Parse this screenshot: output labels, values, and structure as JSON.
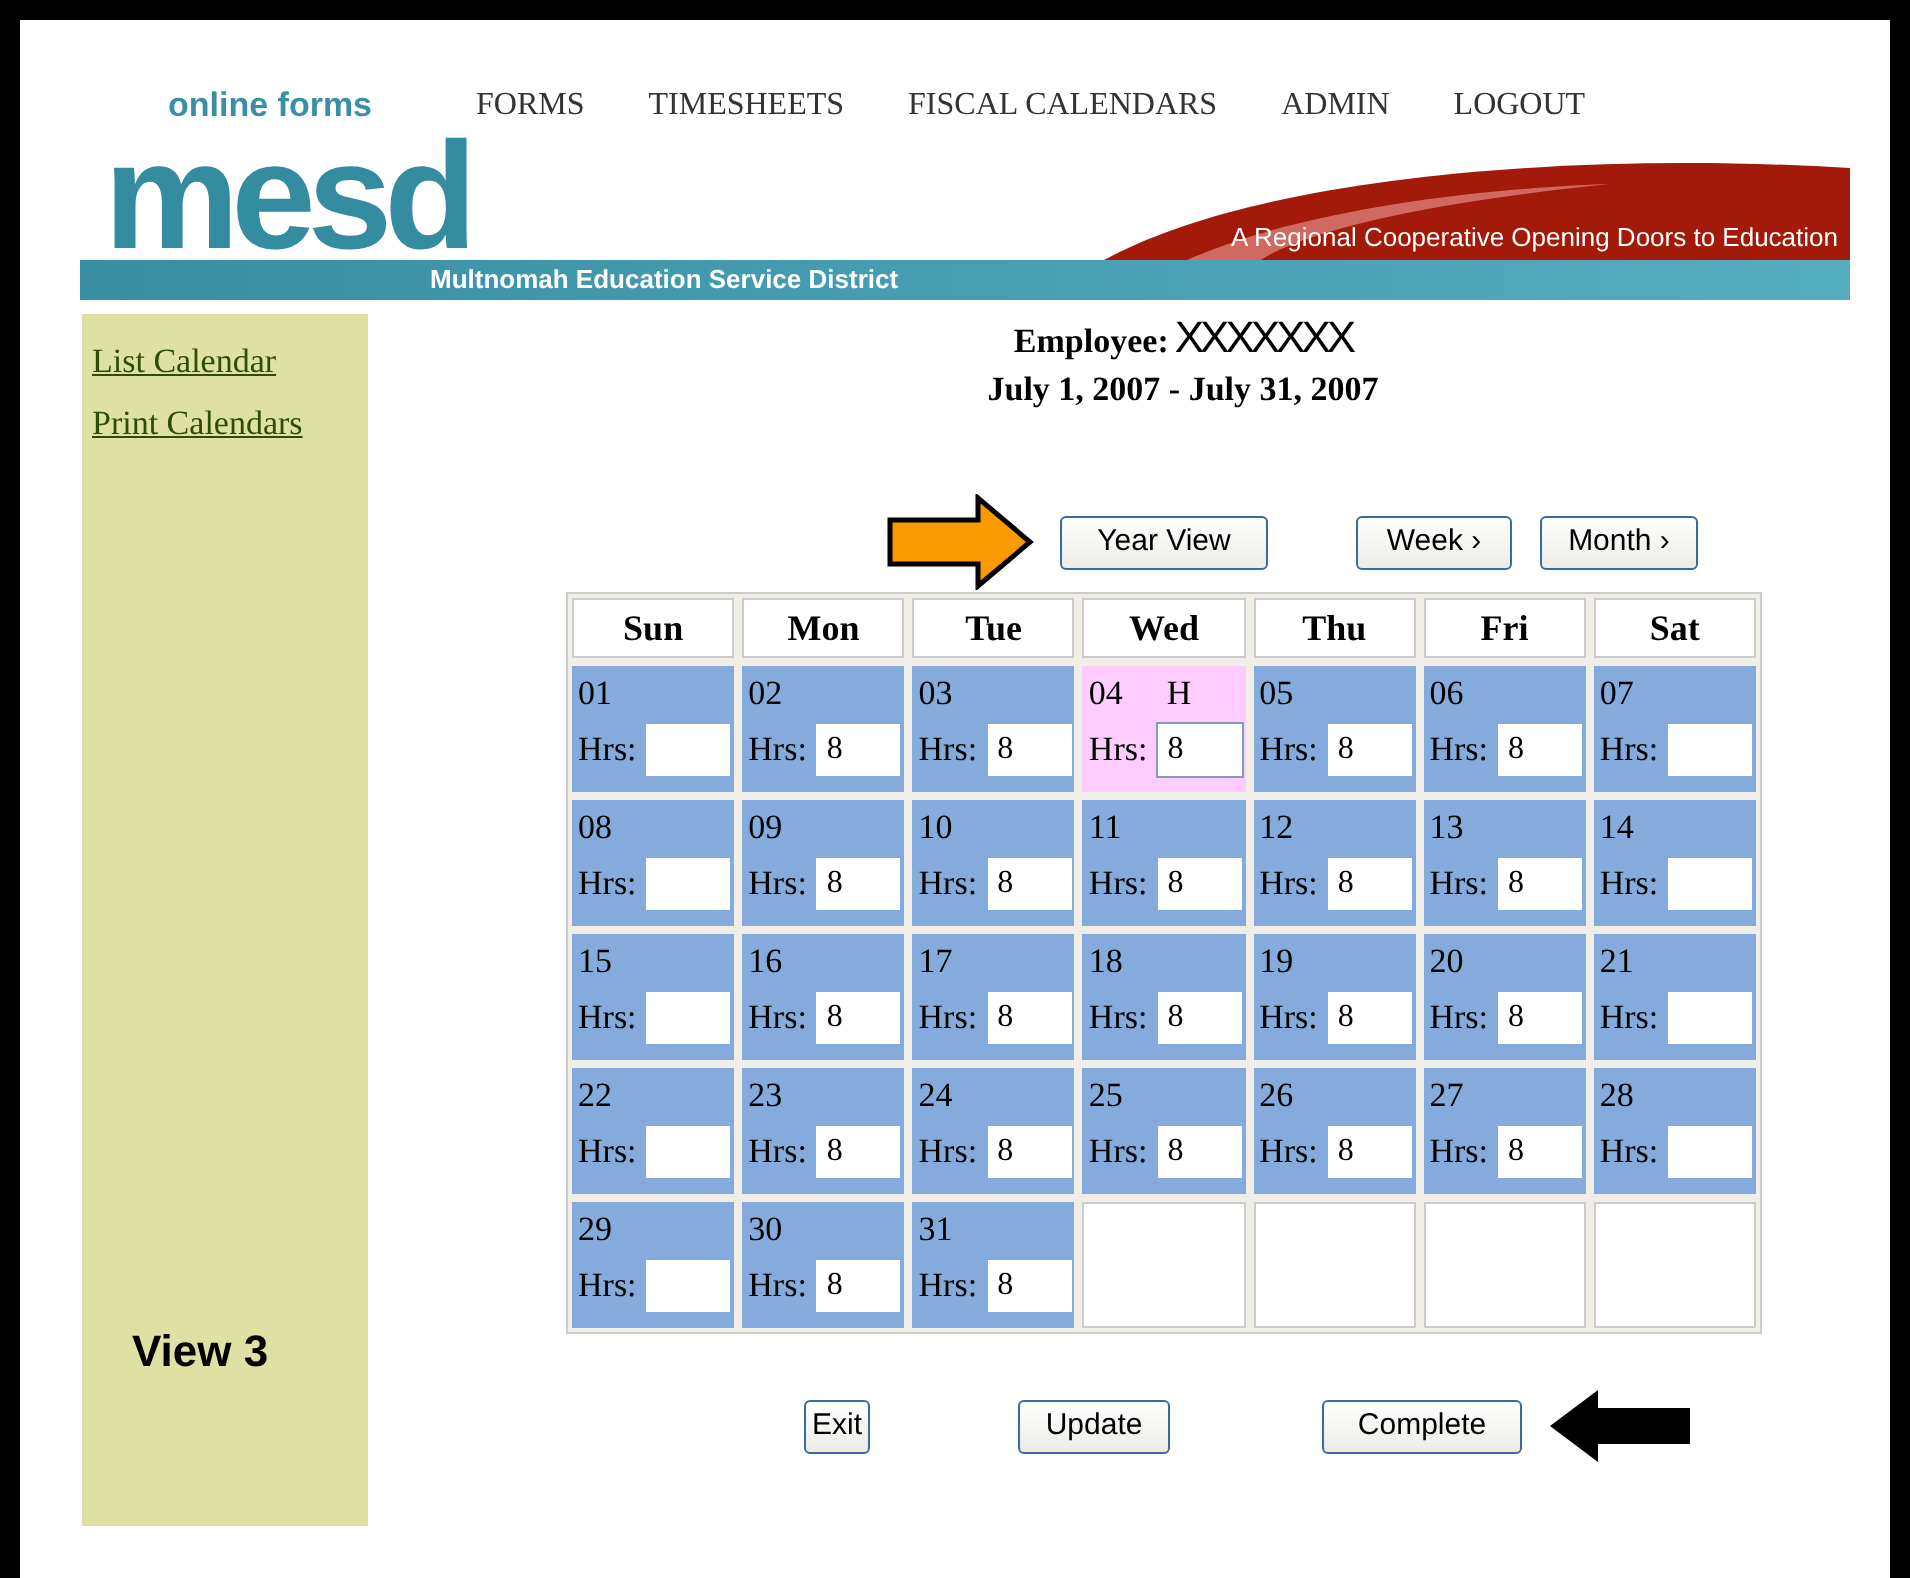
{
  "header": {
    "tagline": "online forms",
    "nav": [
      "FORMS",
      "TIMESHEETS",
      "FISCAL CALENDARS",
      "ADMIN",
      "LOGOUT"
    ],
    "logo": "mesd",
    "slogan": "A Regional Cooperative Opening Doors to Education",
    "district": "Multnomah Education Service District"
  },
  "sidebar": {
    "links": [
      "List Calendar",
      "Print Calendars"
    ],
    "annotation": "View 3"
  },
  "employee": {
    "label": "Employee:",
    "name": "XXXXXXX"
  },
  "period": "July 1, 2007 - July 31, 2007",
  "view_buttons": [
    "Year View",
    "Week ›",
    "Month ›"
  ],
  "calendar": {
    "weekdays": [
      "Sun",
      "Mon",
      "Tue",
      "Wed",
      "Thu",
      "Fri",
      "Sat"
    ],
    "cells": [
      {
        "kind": "day",
        "day": "01",
        "holiday": false,
        "label": "Hrs:"
      },
      {
        "kind": "day",
        "day": "02",
        "holiday": false,
        "label": "Hrs:",
        "hours": "8"
      },
      {
        "kind": "day",
        "day": "03",
        "holiday": false,
        "label": "Hrs:",
        "hours": "8"
      },
      {
        "kind": "day",
        "day": "04",
        "holiday": true,
        "marker": "H",
        "label": "Hrs:",
        "hours": "8"
      },
      {
        "kind": "day",
        "day": "05",
        "holiday": false,
        "label": "Hrs:",
        "hours": "8"
      },
      {
        "kind": "day",
        "day": "06",
        "holiday": false,
        "label": "Hrs:",
        "hours": "8"
      },
      {
        "kind": "day",
        "day": "07",
        "holiday": false,
        "label": "Hrs:"
      },
      {
        "kind": "day",
        "day": "08",
        "holiday": false,
        "label": "Hrs:"
      },
      {
        "kind": "day",
        "day": "09",
        "holiday": false,
        "label": "Hrs:",
        "hours": "8"
      },
      {
        "kind": "day",
        "day": "10",
        "holiday": false,
        "label": "Hrs:",
        "hours": "8"
      },
      {
        "kind": "day",
        "day": "11",
        "holiday": false,
        "label": "Hrs:",
        "hours": "8"
      },
      {
        "kind": "day",
        "day": "12",
        "holiday": false,
        "label": "Hrs:",
        "hours": "8"
      },
      {
        "kind": "day",
        "day": "13",
        "holiday": false,
        "label": "Hrs:",
        "hours": "8"
      },
      {
        "kind": "day",
        "day": "14",
        "holiday": false,
        "label": "Hrs:"
      },
      {
        "kind": "day",
        "day": "15",
        "holiday": false,
        "label": "Hrs:"
      },
      {
        "kind": "day",
        "day": "16",
        "holiday": false,
        "label": "Hrs:",
        "hours": "8"
      },
      {
        "kind": "day",
        "day": "17",
        "holiday": false,
        "label": "Hrs:",
        "hours": "8"
      },
      {
        "kind": "day",
        "day": "18",
        "holiday": false,
        "label": "Hrs:",
        "hours": "8"
      },
      {
        "kind": "day",
        "day": "19",
        "holiday": false,
        "label": "Hrs:",
        "hours": "8"
      },
      {
        "kind": "day",
        "day": "20",
        "holiday": false,
        "label": "Hrs:",
        "hours": "8"
      },
      {
        "kind": "day",
        "day": "21",
        "holiday": false,
        "label": "Hrs:"
      },
      {
        "kind": "day",
        "day": "22",
        "holiday": false,
        "label": "Hrs:"
      },
      {
        "kind": "day",
        "day": "23",
        "holiday": false,
        "label": "Hrs:",
        "hours": "8"
      },
      {
        "kind": "day",
        "day": "24",
        "holiday": false,
        "label": "Hrs:",
        "hours": "8"
      },
      {
        "kind": "day",
        "day": "25",
        "holiday": false,
        "label": "Hrs:",
        "hours": "8"
      },
      {
        "kind": "day",
        "day": "26",
        "holiday": false,
        "label": "Hrs:",
        "hours": "8"
      },
      {
        "kind": "day",
        "day": "27",
        "holiday": false,
        "label": "Hrs:",
        "hours": "8"
      },
      {
        "kind": "day",
        "day": "28",
        "holiday": false,
        "label": "Hrs:"
      },
      {
        "kind": "day",
        "day": "29",
        "holiday": false,
        "label": "Hrs:"
      },
      {
        "kind": "day",
        "day": "30",
        "holiday": false,
        "label": "Hrs:",
        "hours": "8"
      },
      {
        "kind": "day",
        "day": "31",
        "holiday": false,
        "label": "Hrs:",
        "hours": "8"
      },
      {
        "kind": "empty"
      },
      {
        "kind": "empty"
      },
      {
        "kind": "empty"
      },
      {
        "kind": "empty"
      }
    ]
  },
  "actions": [
    "Exit",
    "Update",
    "Complete"
  ]
}
